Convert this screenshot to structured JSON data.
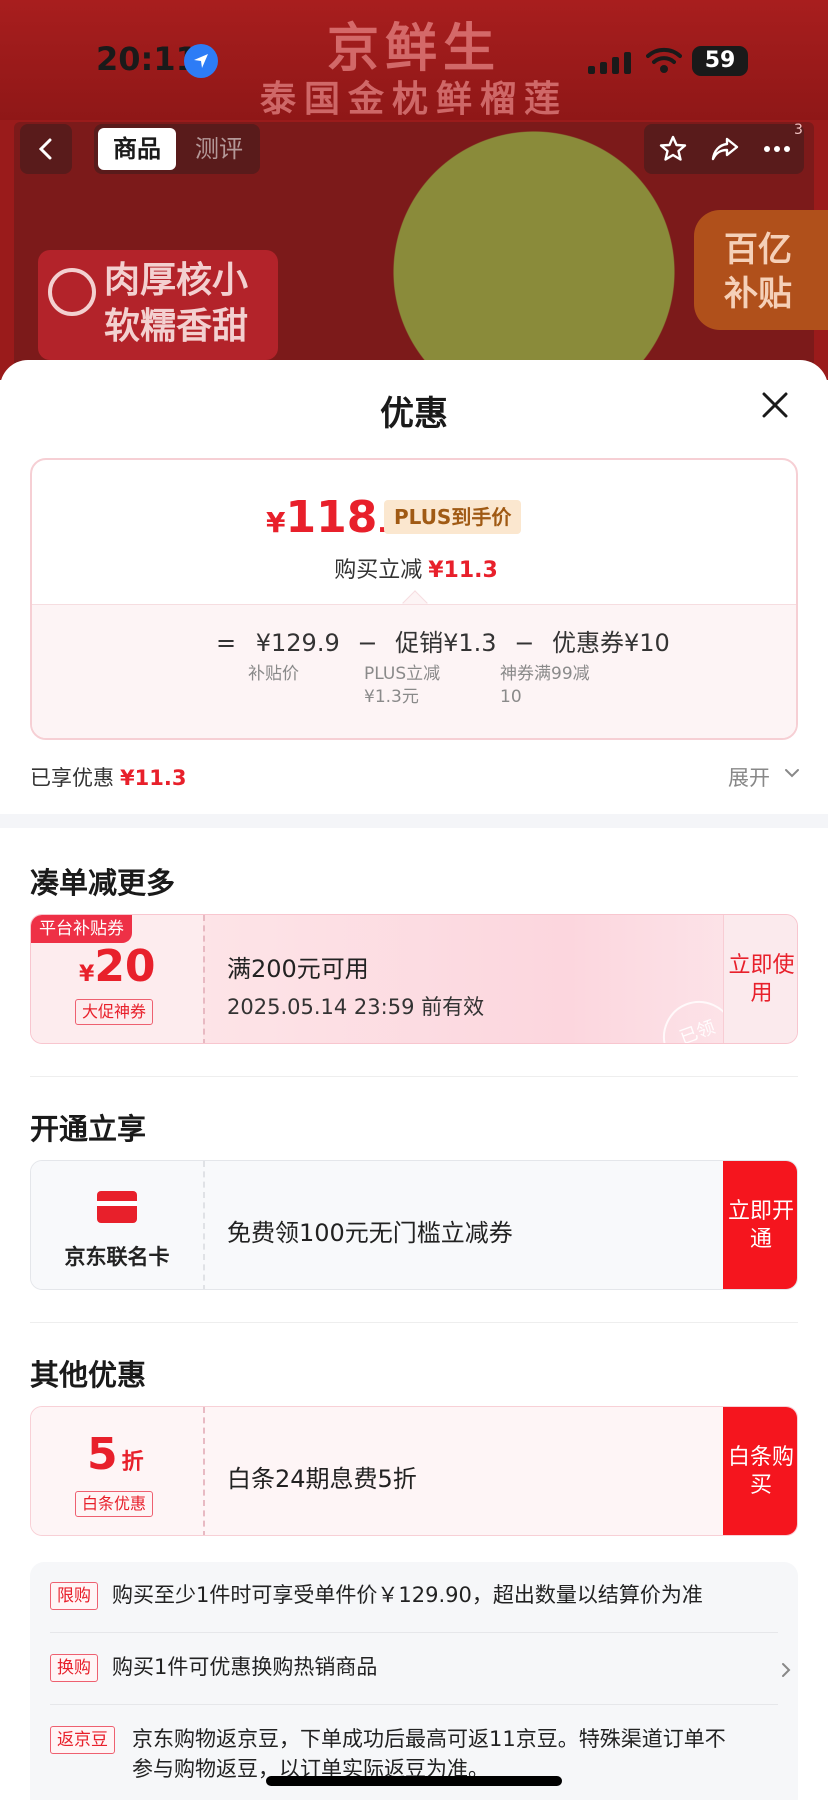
{
  "background": {
    "brand": "京鲜生",
    "subtitle": "泰国金枕鲜榴莲",
    "badge_left_line1": "肉厚核小",
    "badge_left_line2": "软糯香甜",
    "badge_right_line1": "百亿",
    "badge_right_line2": "补贴"
  },
  "status_bar": {
    "time": "20:11",
    "battery": "59"
  },
  "nav": {
    "tabs": [
      "商品",
      "测评"
    ],
    "cart_count": "3"
  },
  "sheet": {
    "title": "优惠",
    "price_card": {
      "currency": "¥",
      "price_int": "118",
      "price_dec": ".6",
      "plus_tag": "PLUS到手价",
      "instant_label": "购买立减",
      "instant_amount": "¥11.3",
      "calc": {
        "eq": "=",
        "base": "¥129.9",
        "minus1": "−",
        "promo": "促销¥1.3",
        "minus2": "−",
        "coupon": "优惠券¥10",
        "base_note": "补贴价",
        "promo_note_1": "PLUS立减",
        "promo_note_2": "¥1.3元",
        "coupon_note_1": "神券满99减",
        "coupon_note_2": "10"
      }
    },
    "enjoyed_label": "已享优惠",
    "enjoyed_amount": "¥11.3",
    "expand_label": "展开",
    "section1": {
      "title": "凑单减更多",
      "coupon": {
        "corner_tag": "平台补贴券",
        "currency": "¥",
        "amount": "20",
        "sub_tag": "大促神券",
        "condition": "满200元可用",
        "validity": "2025.05.14 23:59 前有效",
        "action": "立即使用",
        "stamp": "已领"
      }
    },
    "section2": {
      "title": "开通立享",
      "card": {
        "label": "京东联名卡",
        "desc": "免费领100元无门槛立减券",
        "action": "立即开通"
      }
    },
    "section3": {
      "title": "其他优惠",
      "card": {
        "discount_num": "5",
        "discount_unit": "折",
        "sub_tag": "白条优惠",
        "desc": "白条24期息费5折",
        "action": "白条购买"
      }
    },
    "rules": [
      {
        "tag": "限购",
        "text": "购买至少1件时可享受单件价￥129.90，超出数量以结算价为准"
      },
      {
        "tag": "换购",
        "text": "购买1件可优惠换购热销商品"
      },
      {
        "tag": "返京豆",
        "text_line1": "京东购物返京豆，下单成功后最高可返11京豆。特殊渠道订单不",
        "text_line2": "参与购物返豆，以订单实际返豆为准。"
      }
    ]
  },
  "colors": {
    "accent_red": "#e8202b",
    "plus_gold": "#a05a14",
    "action_red": "#f5151e"
  }
}
